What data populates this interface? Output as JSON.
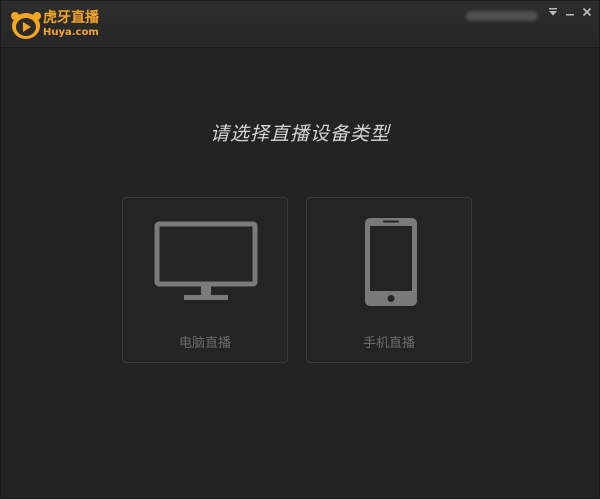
{
  "titlebar": {
    "logo_name": "虎牙直播",
    "logo_url": "Huya.com",
    "icons": {
      "menu": "dropdown-menu-icon",
      "minimize": "minimize-icon",
      "close": "close-icon"
    }
  },
  "main": {
    "heading": "请选择直播设备类型",
    "options": [
      {
        "label": "电脑直播",
        "icon": "monitor-icon"
      },
      {
        "label": "手机直播",
        "icon": "smartphone-icon"
      }
    ]
  },
  "colors": {
    "background": "#232323",
    "brand": "#f5a623",
    "icon": "#7a7a7a",
    "card_border": "#3a3a3a"
  }
}
